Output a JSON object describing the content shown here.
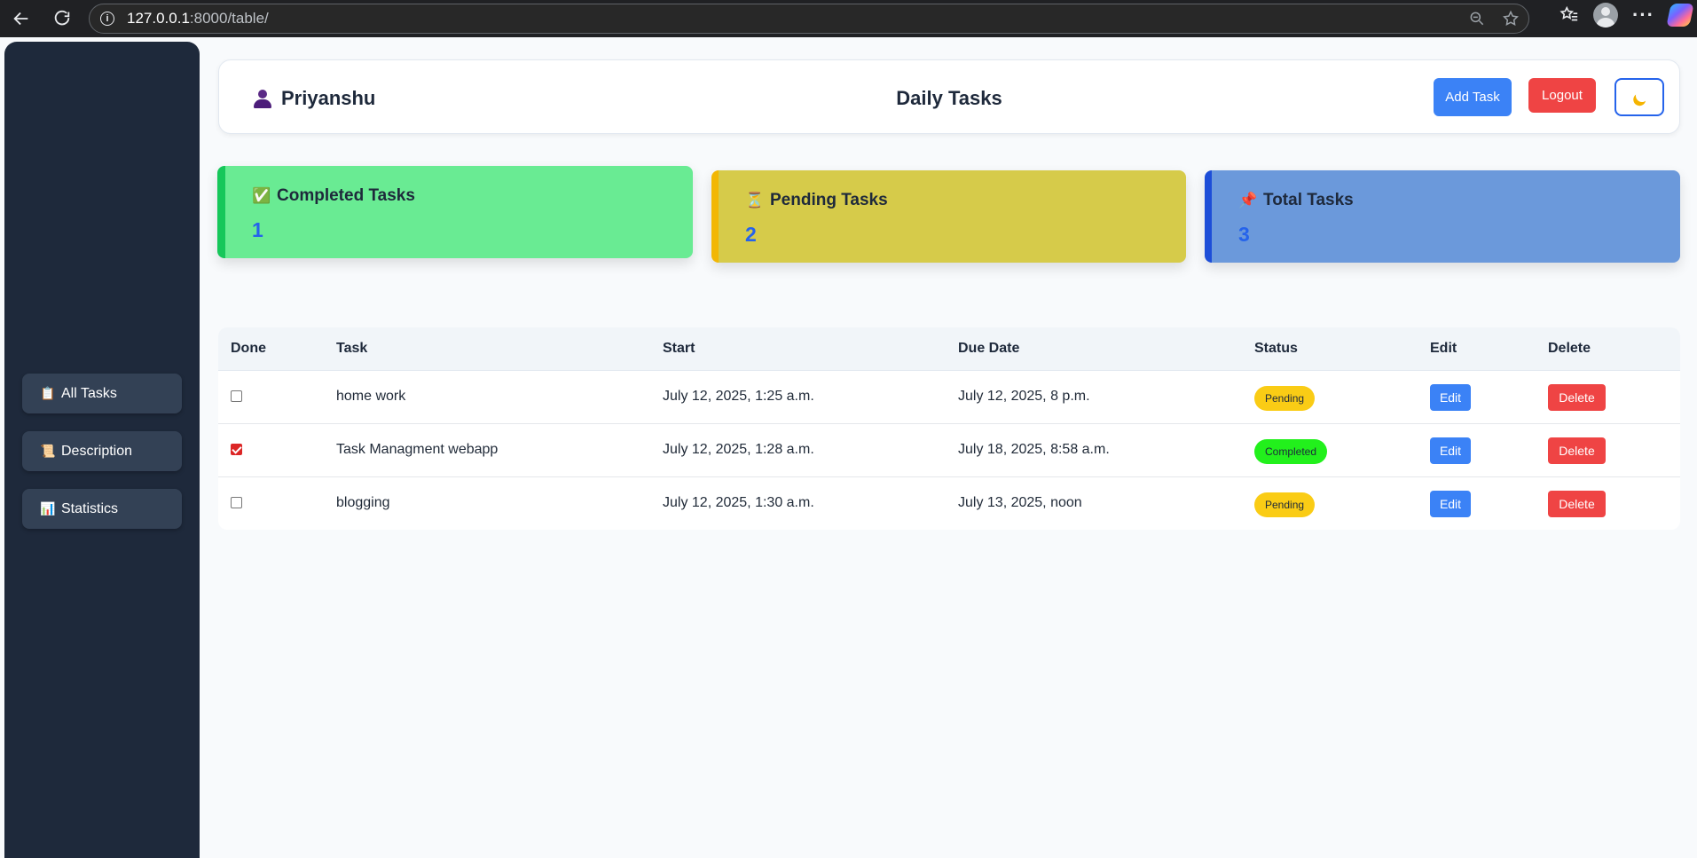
{
  "browser": {
    "url_host": "127.0.0.1",
    "url_rest": ":8000/table/"
  },
  "sidebar": {
    "items": [
      {
        "icon": "📋",
        "label": "All Tasks"
      },
      {
        "icon": "📜",
        "label": "Description"
      },
      {
        "icon": "📊",
        "label": "Statistics"
      }
    ]
  },
  "header": {
    "user_name": "Priyanshu",
    "title": "Daily Tasks",
    "add_task_label": "Add Task",
    "logout_label": "Logout"
  },
  "stats": {
    "completed": {
      "icon": "✅",
      "label": "Completed Tasks",
      "value": "1"
    },
    "pending": {
      "icon": "⏳",
      "label": "Pending Tasks",
      "value": "2"
    },
    "total": {
      "icon": "📌",
      "label": "Total Tasks",
      "value": "3"
    }
  },
  "table": {
    "headers": [
      "Done",
      "Task",
      "Start",
      "Due Date",
      "Status",
      "Edit",
      "Delete"
    ],
    "rows": [
      {
        "done": false,
        "task": "home work",
        "start": "July 12, 2025, 1:25 a.m.",
        "due": "July 12, 2025, 8 p.m.",
        "status": "Pending",
        "edit": "Edit",
        "delete": "Delete"
      },
      {
        "done": true,
        "task": "Task Managment webapp",
        "start": "July 12, 2025, 1:28 a.m.",
        "due": "July 18, 2025, 8:58 a.m.",
        "status": "Completed",
        "edit": "Edit",
        "delete": "Delete"
      },
      {
        "done": false,
        "task": "blogging",
        "start": "July 12, 2025, 1:30 a.m.",
        "due": "July 13, 2025, noon",
        "status": "Pending",
        "edit": "Edit",
        "delete": "Delete"
      }
    ]
  },
  "colors": {
    "sidebar_bg": "#1e293b",
    "primary": "#3b82f6",
    "danger": "#ef4444",
    "completed_card": "#69eb93",
    "pending_card": "#d6cb4a",
    "total_card": "#6b99db",
    "pending_badge": "#facc15",
    "completed_badge": "#22f01c"
  }
}
